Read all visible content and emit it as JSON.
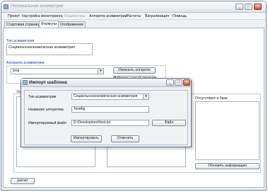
{
  "window": {
    "title": "Региональная асимметрия",
    "controls": [
      "_",
      "□",
      "x"
    ]
  },
  "menu": {
    "items": [
      {
        "label": "Проект",
        "disabled": false
      },
      {
        "label": "Настройка мониторинга",
        "disabled": false
      },
      {
        "label": "Индикаторы",
        "disabled": true
      },
      {
        "label": "Алгоритм асимметрии",
        "disabled": false
      },
      {
        "label": "Расчеты",
        "disabled": false
      },
      {
        "label": "Визуализация",
        "disabled": false
      },
      {
        "label": "Помощь",
        "disabled": false
      }
    ]
  },
  "tabs": [
    {
      "label": "Стартовая страница",
      "active": false
    },
    {
      "label": "Формулы",
      "active": true
    },
    {
      "label": "Отображение",
      "active": false
    }
  ],
  "main": {
    "type_group_label": "Тип асимметрии",
    "type_value": "Социальноэкономическая асимметрия",
    "algorithm_group_label": "Алгоритм асимметрии",
    "algorithm_value": "tesa",
    "change_algorithm_button": "Изменить алгоритм",
    "add_algorithm_button": "Добавить новый алгоритм",
    "hidden_group_label_fragment": "Зап",
    "missing_label": "Отсутствует в базе",
    "update_button": "Обновить информацию",
    "calc_button": "расчет"
  },
  "dialog": {
    "title": "Импорт шаблона",
    "controls": [
      "_",
      "□",
      "x"
    ],
    "type_label": "Тип асимметрии",
    "type_value": "Социальноэкономическая асимметрия",
    "name_label": "Название алгоритма",
    "name_value": "TestAlg",
    "file_label": "Импортируемый файл",
    "file_value": "D:\\Development\\test.txt",
    "file_button": "Файл",
    "import_button": "Импортировать",
    "cancel_button": "Отменить"
  }
}
